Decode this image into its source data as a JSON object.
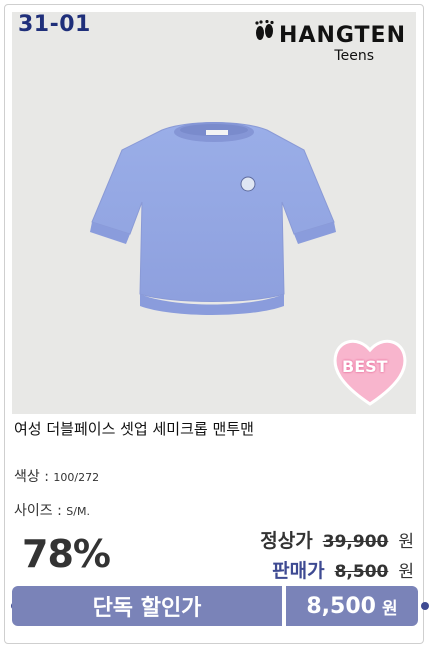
{
  "product": {
    "code": "31-01",
    "brand_name": "HANGTEN",
    "brand_sub": "Teens",
    "badge": "BEST",
    "title": "여성 더블페이스 셋업 세미크롭 맨투맨",
    "color_label": "색상 :",
    "color_value": "100/272",
    "size_label": "사이즈 :",
    "size_value": "S/M.",
    "discount": "78%",
    "regular_label": "정상가",
    "regular_price": "39,900",
    "sale_label": "판매가",
    "sale_price": "8,500",
    "currency": "원",
    "exclusive_label": "단독 할인가",
    "final_price": "8,500",
    "colors": {
      "shirt": "#94a6e4",
      "button": "#7a83b8",
      "regular_label": "#333333",
      "sale_label": "#3e4a92",
      "badge_pink": "#f6a9c4"
    }
  }
}
